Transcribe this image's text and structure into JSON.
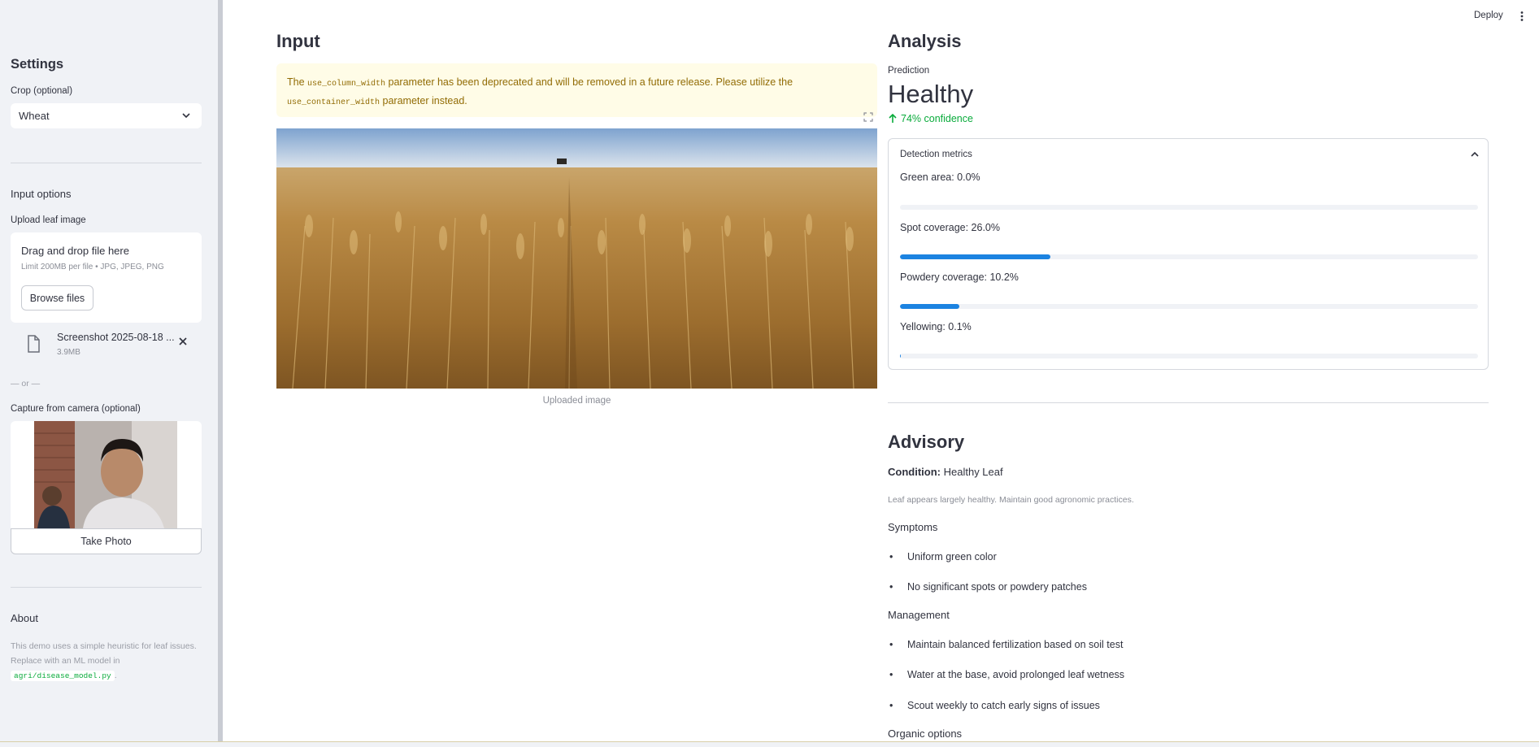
{
  "topbar": {
    "deploy_label": "Deploy",
    "menu_icon": "kebab-menu-icon"
  },
  "sidebar": {
    "settings_heading": "Settings",
    "crop_label": "Crop (optional)",
    "crop_selected": "Wheat",
    "input_options_heading": "Input options",
    "upload_label": "Upload leaf image",
    "dropzone_title": "Drag and drop file here",
    "dropzone_limit": "Limit 200MB per file • JPG, JPEG, PNG",
    "browse_label": "Browse files",
    "file_name": "Screenshot 2025-08-18 ...",
    "file_size": "3.9MB",
    "or_text": "— or —",
    "camera_label": "Capture from camera (optional)",
    "take_photo_label": "Take Photo",
    "about_heading": "About",
    "about_text": "This demo uses a simple heuristic for leaf issues. Replace with an ML model in",
    "about_code": "agri/disease_model.py",
    "about_period": "."
  },
  "input": {
    "heading": "Input",
    "warning_prefix": "The",
    "warning_code1": "use_column_width",
    "warning_middle": "parameter has been deprecated and will be removed in a future release. Please utilize the",
    "warning_code2": "use_container_width",
    "warning_suffix": "parameter instead.",
    "image_caption": "Uploaded image"
  },
  "analysis": {
    "heading": "Analysis",
    "prediction_label": "Prediction",
    "prediction_value": "Healthy",
    "confidence_delta": "74% confidence",
    "metrics_title": "Detection metrics",
    "metrics": [
      {
        "label": "Green area: 0.0%",
        "value": 0.0
      },
      {
        "label": "Spot coverage: 26.0%",
        "value": 26.0
      },
      {
        "label": "Powdery coverage: 10.2%",
        "value": 10.2
      },
      {
        "label": "Yellowing: 0.1%",
        "value": 0.1
      }
    ]
  },
  "advisory": {
    "heading": "Advisory",
    "condition_key": "Condition:",
    "condition_value": "Healthy Leaf",
    "description": "Leaf appears largely healthy. Maintain good agronomic practices.",
    "symptoms_label": "Symptoms",
    "symptoms": [
      "Uniform green color",
      "No significant spots or powdery patches"
    ],
    "management_label": "Management",
    "management": [
      "Maintain balanced fertilization based on soil test",
      "Water at the base, avoid prolonged leaf wetness",
      "Scout weekly to catch early signs of issues"
    ],
    "organic_label": "Organic options"
  },
  "colors": {
    "accent": "#1c83e1",
    "success": "#09ab3b",
    "warning_bg": "#fffce7",
    "warning_text": "#926c05",
    "sidebar_bg": "#f0f2f6"
  }
}
